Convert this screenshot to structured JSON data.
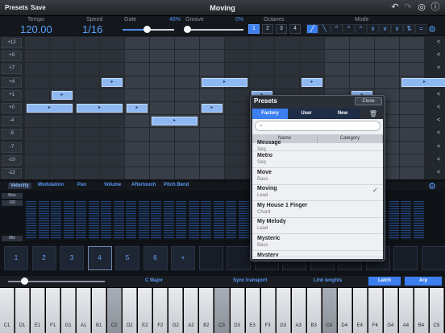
{
  "topbar": {
    "presets_label": "Presets",
    "save_label": "Save",
    "title": "Moving"
  },
  "controls": {
    "tempo_label": "Tempo",
    "tempo_value": "120.00",
    "speed_label": "Speed",
    "speed_value": "1/16",
    "gate_label": "Gate",
    "gate_pct": "48%",
    "gate_level": 0.48,
    "groove_label": "Groove",
    "groove_pct": "0%",
    "groove_level": 0.0,
    "octaves_label": "Octaves",
    "octaves": [
      "1",
      "2",
      "3",
      "4"
    ],
    "octave_selected": "1",
    "mode_label": "Mode",
    "mode_icons": [
      "up-ramp-icon",
      "down-ramp-icon",
      "caret-up-icon",
      "caret-up-icon",
      "caret-up-icon",
      "caret-down-icon",
      "caret-down-icon",
      "caret-down-icon",
      "updown-icon",
      "equals-icon"
    ],
    "mode_glyphs": [
      "╱",
      "╲",
      "^",
      "^",
      "^",
      "∨",
      "∨",
      "∨",
      "⇅",
      "="
    ]
  },
  "grid": {
    "row_labels": [
      "+12",
      "+9",
      "+7",
      "+4",
      "+1",
      "+0",
      "-4",
      "-5",
      "-7",
      "-10",
      "-12"
    ],
    "notes": [
      {
        "row": 5,
        "col": 0,
        "span": 2,
        "label": "▸"
      },
      {
        "row": 5,
        "col": 2,
        "span": 2,
        "label": "▸"
      },
      {
        "row": 4,
        "col": 1,
        "span": 1,
        "label": "▸"
      },
      {
        "row": 3,
        "col": 3,
        "span": 1,
        "label": "▸"
      },
      {
        "row": 5,
        "col": 4,
        "span": 1,
        "label": "▸"
      },
      {
        "row": 6,
        "col": 5,
        "span": 2,
        "label": "▸"
      },
      {
        "row": 5,
        "col": 7,
        "span": 1,
        "label": "▸"
      },
      {
        "row": 3,
        "col": 7,
        "span": 2,
        "label": "▸"
      },
      {
        "row": 4,
        "col": 9,
        "span": 1,
        "label": "▸"
      },
      {
        "row": 5,
        "col": 10,
        "span": 2,
        "label": "▸"
      },
      {
        "row": 3,
        "col": 11,
        "span": 1,
        "label": "▸"
      },
      {
        "row": 4,
        "col": 13,
        "span": 1,
        "label": "▸"
      },
      {
        "row": 3,
        "col": 15,
        "span": 2,
        "label": "▸"
      }
    ],
    "chevron": "<"
  },
  "velocity": {
    "tabs": [
      "Velocity",
      "Modulation",
      "Pan",
      "Volume",
      "Aftertouch",
      "Pitch Bend"
    ],
    "max_label": "Max",
    "value_label": "100",
    "min_label": "Min"
  },
  "steps": {
    "buttons": [
      "1",
      "2",
      "3",
      "4",
      "5",
      "6",
      "+"
    ],
    "selected": "4"
  },
  "bottombar": {
    "scale": "C Major",
    "sync": "Sync transport",
    "link": "Link lenghts",
    "latch": "Latch",
    "arp": "Arp"
  },
  "keyboard": {
    "keys": [
      "C1",
      "D1",
      "E1",
      "F1",
      "G1",
      "A1",
      "B1",
      "C2",
      "D2",
      "E2",
      "F2",
      "G2",
      "A2",
      "B2",
      "C3",
      "D3",
      "E3",
      "F3",
      "G3",
      "A3",
      "B3",
      "C4",
      "D4",
      "E4",
      "F4",
      "G4",
      "A4",
      "B4",
      "C5"
    ],
    "played": [
      "C2",
      "C3",
      "C4"
    ]
  },
  "presets": {
    "title": "Presets",
    "close_label": "Close",
    "tabs": [
      "Factory",
      "User",
      "New"
    ],
    "active_tab": "Factory",
    "search_placeholder": "",
    "col_name": "Name",
    "col_category": "Category",
    "items": [
      {
        "name": "Message",
        "category": "Seq"
      },
      {
        "name": "Metro",
        "category": "Seq"
      },
      {
        "name": "Move",
        "category": "Bass"
      },
      {
        "name": "Moving",
        "category": "Lead",
        "checked": true
      },
      {
        "name": "My House 1 Finger",
        "category": "Chord"
      },
      {
        "name": "My Melody",
        "category": "Lead"
      },
      {
        "name": "Mysteric",
        "category": "Bass"
      },
      {
        "name": "Mystery",
        "category": ""
      }
    ],
    "check_glyph": "✓"
  }
}
